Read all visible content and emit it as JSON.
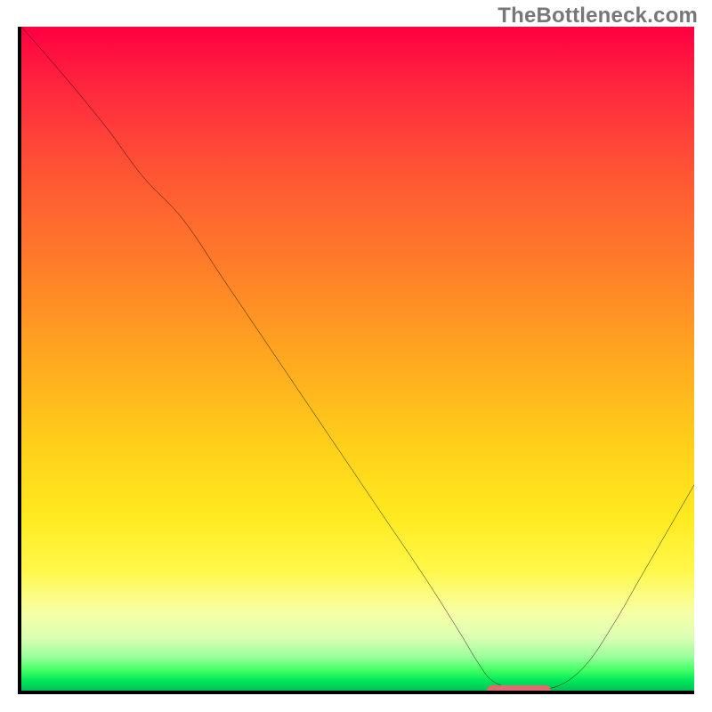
{
  "watermark": "TheBottleneck.com",
  "chart_data": {
    "type": "line",
    "title": "",
    "xlabel": "",
    "ylabel": "",
    "xlim": [
      0,
      100
    ],
    "ylim": [
      0,
      100
    ],
    "grid": false,
    "background": "vertical_gradient_red_to_green",
    "series": [
      {
        "name": "bottleneck-curve",
        "color": "#000000",
        "x": [
          0,
          6,
          12.5,
          18,
          24,
          30,
          36,
          42,
          48,
          54,
          60,
          65,
          68,
          70,
          73,
          76,
          80,
          84,
          88,
          92,
          96,
          100
        ],
        "y": [
          100,
          93,
          85,
          77.5,
          71,
          62,
          53,
          44,
          35,
          26,
          17,
          9,
          4,
          1.5,
          0.3,
          0.2,
          0.8,
          4,
          10,
          17,
          24,
          31
        ]
      }
    ],
    "marker": {
      "name": "bottleneck-minimum",
      "shape": "pill",
      "color": "#e06a6f",
      "x_center": 74,
      "y": 0,
      "width_pct": 9.5
    }
  }
}
